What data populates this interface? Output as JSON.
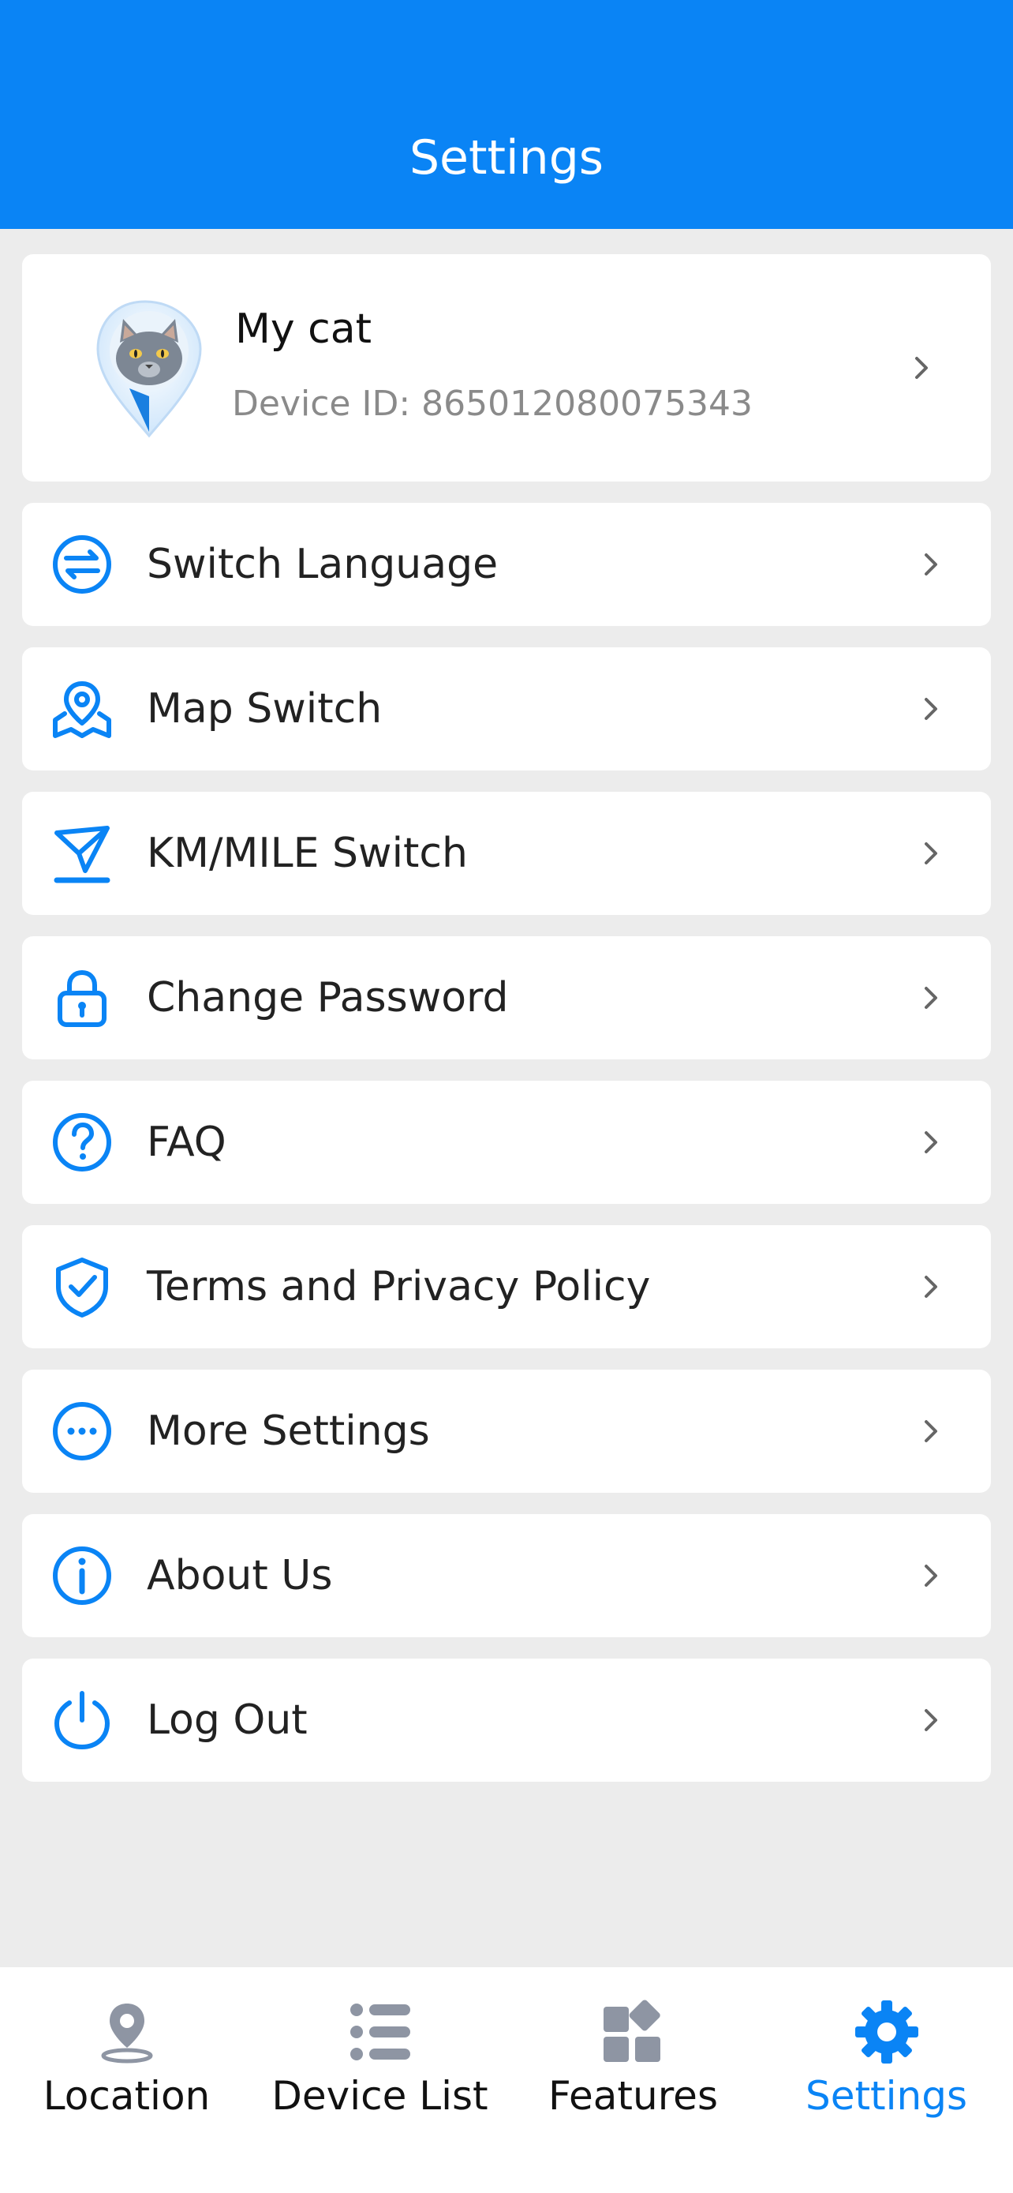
{
  "header": {
    "title": "Settings"
  },
  "device": {
    "name": "My cat",
    "id_text": "Device ID: 865012080075343"
  },
  "menu": [
    {
      "label": "Switch Language",
      "icon": "language-switch-icon"
    },
    {
      "label": "Map Switch",
      "icon": "map-pin-icon"
    },
    {
      "label": "KM/MILE Switch",
      "icon": "distance-icon"
    },
    {
      "label": "Change Password",
      "icon": "lock-icon"
    },
    {
      "label": "FAQ",
      "icon": "question-icon"
    },
    {
      "label": "Terms and Privacy Policy",
      "icon": "shield-check-icon"
    },
    {
      "label": "More Settings",
      "icon": "more-icon"
    },
    {
      "label": "About Us",
      "icon": "info-icon"
    },
    {
      "label": "Log Out",
      "icon": "power-icon"
    }
  ],
  "tabs": [
    {
      "label": "Location",
      "icon": "location-pin-icon"
    },
    {
      "label": "Device List",
      "icon": "list-icon"
    },
    {
      "label": "Features",
      "icon": "grid-icon"
    },
    {
      "label": "Settings",
      "icon": "gear-icon",
      "active": true
    }
  ],
  "colors": {
    "accent": "#0a84f5",
    "background": "#ececec",
    "inactive_icon": "#8e95a3"
  }
}
